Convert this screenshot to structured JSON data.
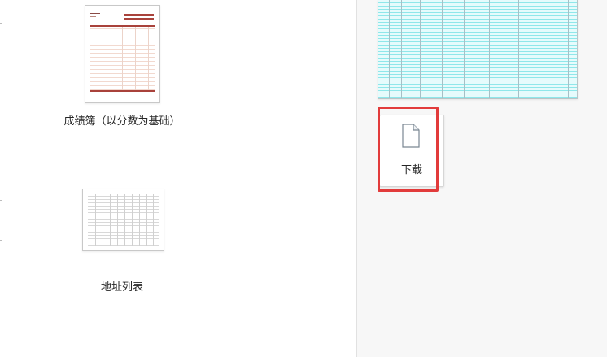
{
  "templates": [
    {
      "label": "成绩簿（以分数为基础）",
      "thumbnail_icon": "gradebook-thumbnail"
    },
    {
      "label": "地址列表",
      "thumbnail_icon": "address-list-thumbnail"
    }
  ],
  "preview": {
    "thumbnail_icon": "spreadsheet-preview"
  },
  "download": {
    "label": "下载",
    "icon": "document-icon",
    "highlight_color": "#e23b3b"
  },
  "colors": {
    "gradebook_accent": "#a9423b",
    "preview_fill": "#e6fbfc",
    "preview_rule": "#8fe7ea"
  }
}
